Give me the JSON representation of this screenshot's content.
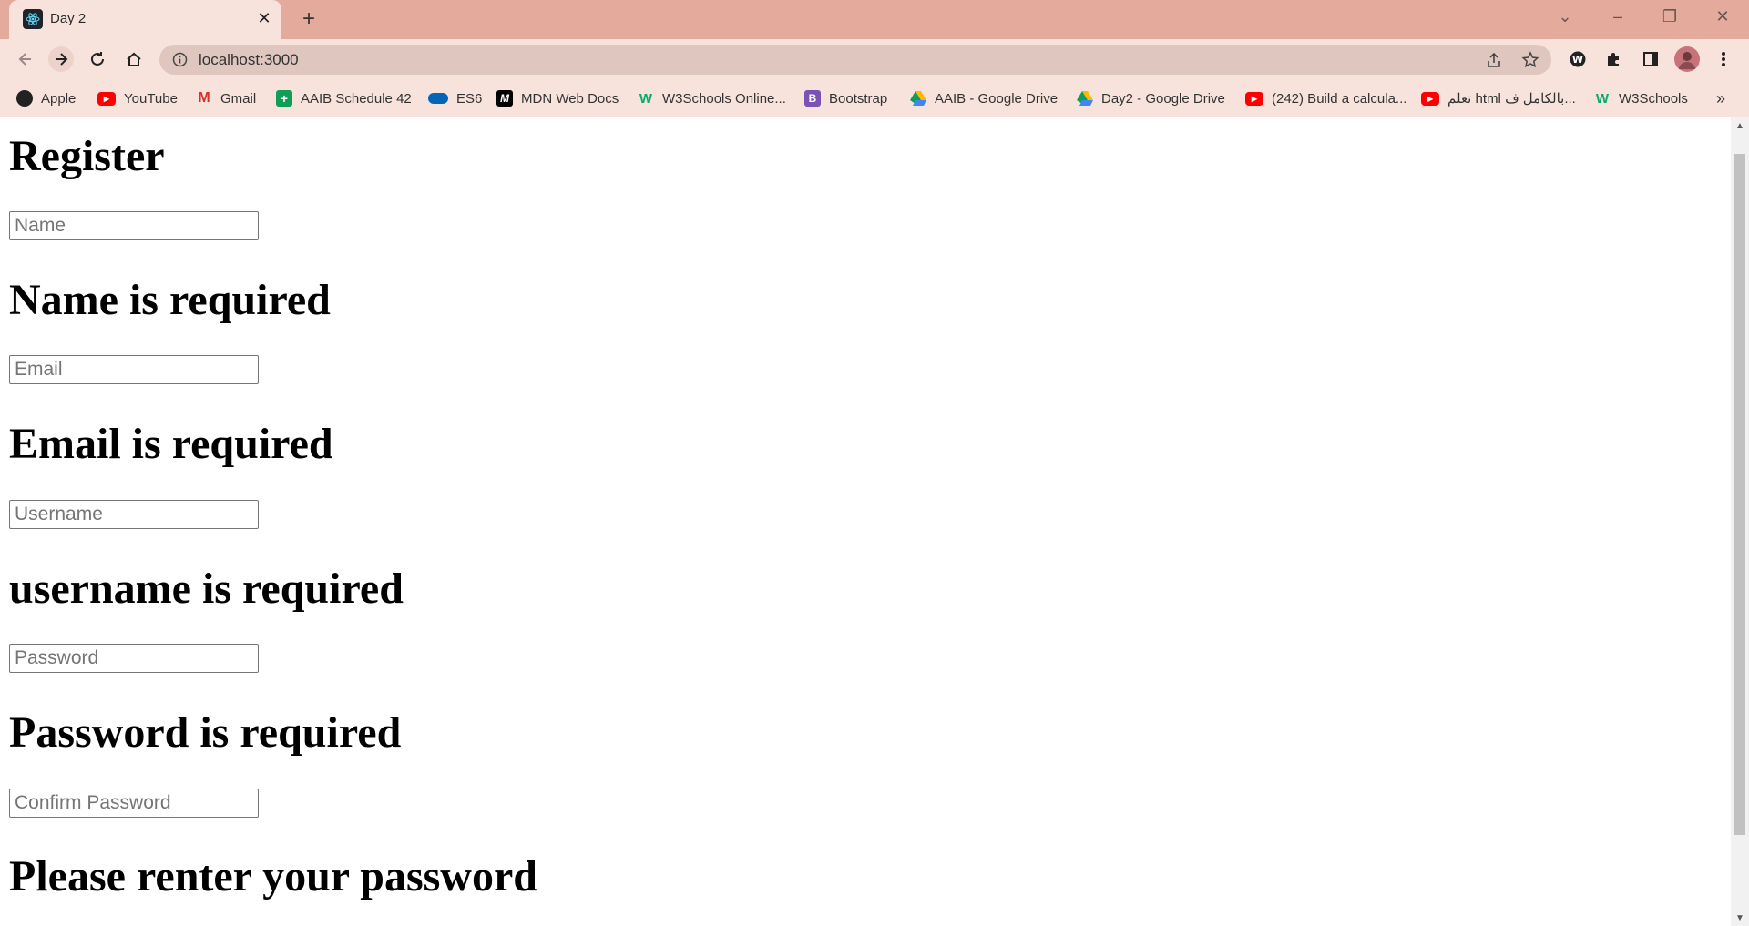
{
  "browser": {
    "tab_title": "Day 2",
    "url": "localhost:3000",
    "bookmarks": [
      {
        "label": "Apple",
        "icon": "apple-icon",
        "color": "#222222"
      },
      {
        "label": "YouTube",
        "icon": "youtube-icon",
        "color": "#ff0000"
      },
      {
        "label": "Gmail",
        "icon": "gmail-icon",
        "color": "#d93025"
      },
      {
        "label": "AAIB Schedule 42",
        "icon": "sheets-icon",
        "color": "#0f9d58"
      },
      {
        "label": "ES6",
        "icon": "onedrive-icon",
        "color": "#0364b8"
      },
      {
        "label": "MDN Web Docs",
        "icon": "mdn-icon",
        "color": "#000000"
      },
      {
        "label": "W3Schools Online...",
        "icon": "w3schools-icon",
        "color": "#04aa6d"
      },
      {
        "label": "Bootstrap",
        "icon": "bootstrap-icon",
        "color": "#7952b3"
      },
      {
        "label": "AAIB - Google Drive",
        "icon": "google-drive-icon",
        "color": "#1fa463"
      },
      {
        "label": "Day2 - Google Drive",
        "icon": "google-drive-icon",
        "color": "#1fa463"
      },
      {
        "label": "(242) Build a calcula...",
        "icon": "youtube-icon",
        "color": "#ff0000"
      },
      {
        "label": "تعلم html بالكامل ف...",
        "icon": "youtube-icon",
        "color": "#ff0000"
      },
      {
        "label": "W3Schools",
        "icon": "w3schools-icon",
        "color": "#04aa6d"
      }
    ],
    "more_bookmarks": "»"
  },
  "page": {
    "heading": "Register",
    "fields": [
      {
        "placeholder": "Name",
        "error": "Name is required"
      },
      {
        "placeholder": "Email",
        "error": "Email is required"
      },
      {
        "placeholder": "Username",
        "error": "username is required"
      },
      {
        "placeholder": "Password",
        "error": "Password is required"
      },
      {
        "placeholder": "Confirm Password",
        "error": "Please renter your password"
      }
    ]
  }
}
